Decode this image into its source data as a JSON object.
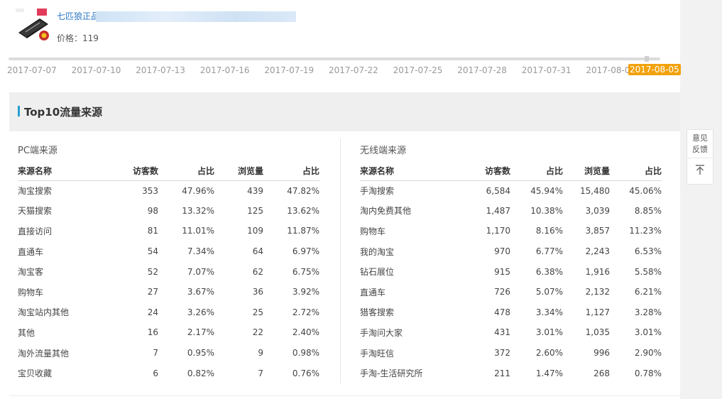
{
  "product": {
    "name": "七匹狼正品",
    "price": "价格：119"
  },
  "timeline": {
    "ticks": [
      "2017-07-07",
      "2017-07-10",
      "2017-07-13",
      "2017-07-16",
      "2017-07-19",
      "2017-07-22",
      "2017-07-25",
      "2017-07-28",
      "2017-07-31",
      "2017-08-03"
    ],
    "selected": "2017-08-05"
  },
  "section": {
    "title": "Top10流量来源"
  },
  "pc": {
    "title": "PC端来源",
    "headers": [
      "来源名称",
      "访客数",
      "占比",
      "浏览量",
      "占比"
    ],
    "rows": [
      [
        "淘宝搜索",
        "353",
        "47.96%",
        "439",
        "47.82%"
      ],
      [
        "天猫搜索",
        "98",
        "13.32%",
        "125",
        "13.62%"
      ],
      [
        "直接访问",
        "81",
        "11.01%",
        "109",
        "11.87%"
      ],
      [
        "直通车",
        "54",
        "7.34%",
        "64",
        "6.97%"
      ],
      [
        "淘宝客",
        "52",
        "7.07%",
        "62",
        "6.75%"
      ],
      [
        "购物车",
        "27",
        "3.67%",
        "36",
        "3.92%"
      ],
      [
        "淘宝站内其他",
        "24",
        "3.26%",
        "25",
        "2.72%"
      ],
      [
        "其他",
        "16",
        "2.17%",
        "22",
        "2.40%"
      ],
      [
        "淘外流量其他",
        "7",
        "0.95%",
        "9",
        "0.98%"
      ],
      [
        "宝贝收藏",
        "6",
        "0.82%",
        "7",
        "0.76%"
      ]
    ]
  },
  "mobile": {
    "title": "无线端来源",
    "headers": [
      "来源名称",
      "访客数",
      "占比",
      "浏览量",
      "占比"
    ],
    "rows": [
      [
        "手淘搜索",
        "6,584",
        "45.94%",
        "15,480",
        "45.06%"
      ],
      [
        "淘内免费其他",
        "1,487",
        "10.38%",
        "3,039",
        "8.85%"
      ],
      [
        "购物车",
        "1,170",
        "8.16%",
        "3,857",
        "11.23%"
      ],
      [
        "我的淘宝",
        "970",
        "6.77%",
        "2,243",
        "6.53%"
      ],
      [
        "钻石展位",
        "915",
        "6.38%",
        "1,916",
        "5.58%"
      ],
      [
        "直通车",
        "726",
        "5.07%",
        "2,132",
        "6.21%"
      ],
      [
        "猎客搜索",
        "478",
        "3.34%",
        "1,127",
        "3.28%"
      ],
      [
        "手淘问大家",
        "431",
        "3.01%",
        "1,035",
        "3.01%"
      ],
      [
        "手淘旺信",
        "372",
        "2.60%",
        "996",
        "2.90%"
      ],
      [
        "手淘-生活研究所",
        "211",
        "1.47%",
        "268",
        "0.78%"
      ]
    ]
  },
  "sidebar": {
    "feedback_line1": "意见",
    "feedback_line2": "反馈"
  },
  "colors": {
    "accent": "#29a0d0",
    "selected_date": "#f2a20c",
    "link": "#2b78c5"
  },
  "icons": [
    "product-thumbnail-icon",
    "back-to-top-icon"
  ]
}
